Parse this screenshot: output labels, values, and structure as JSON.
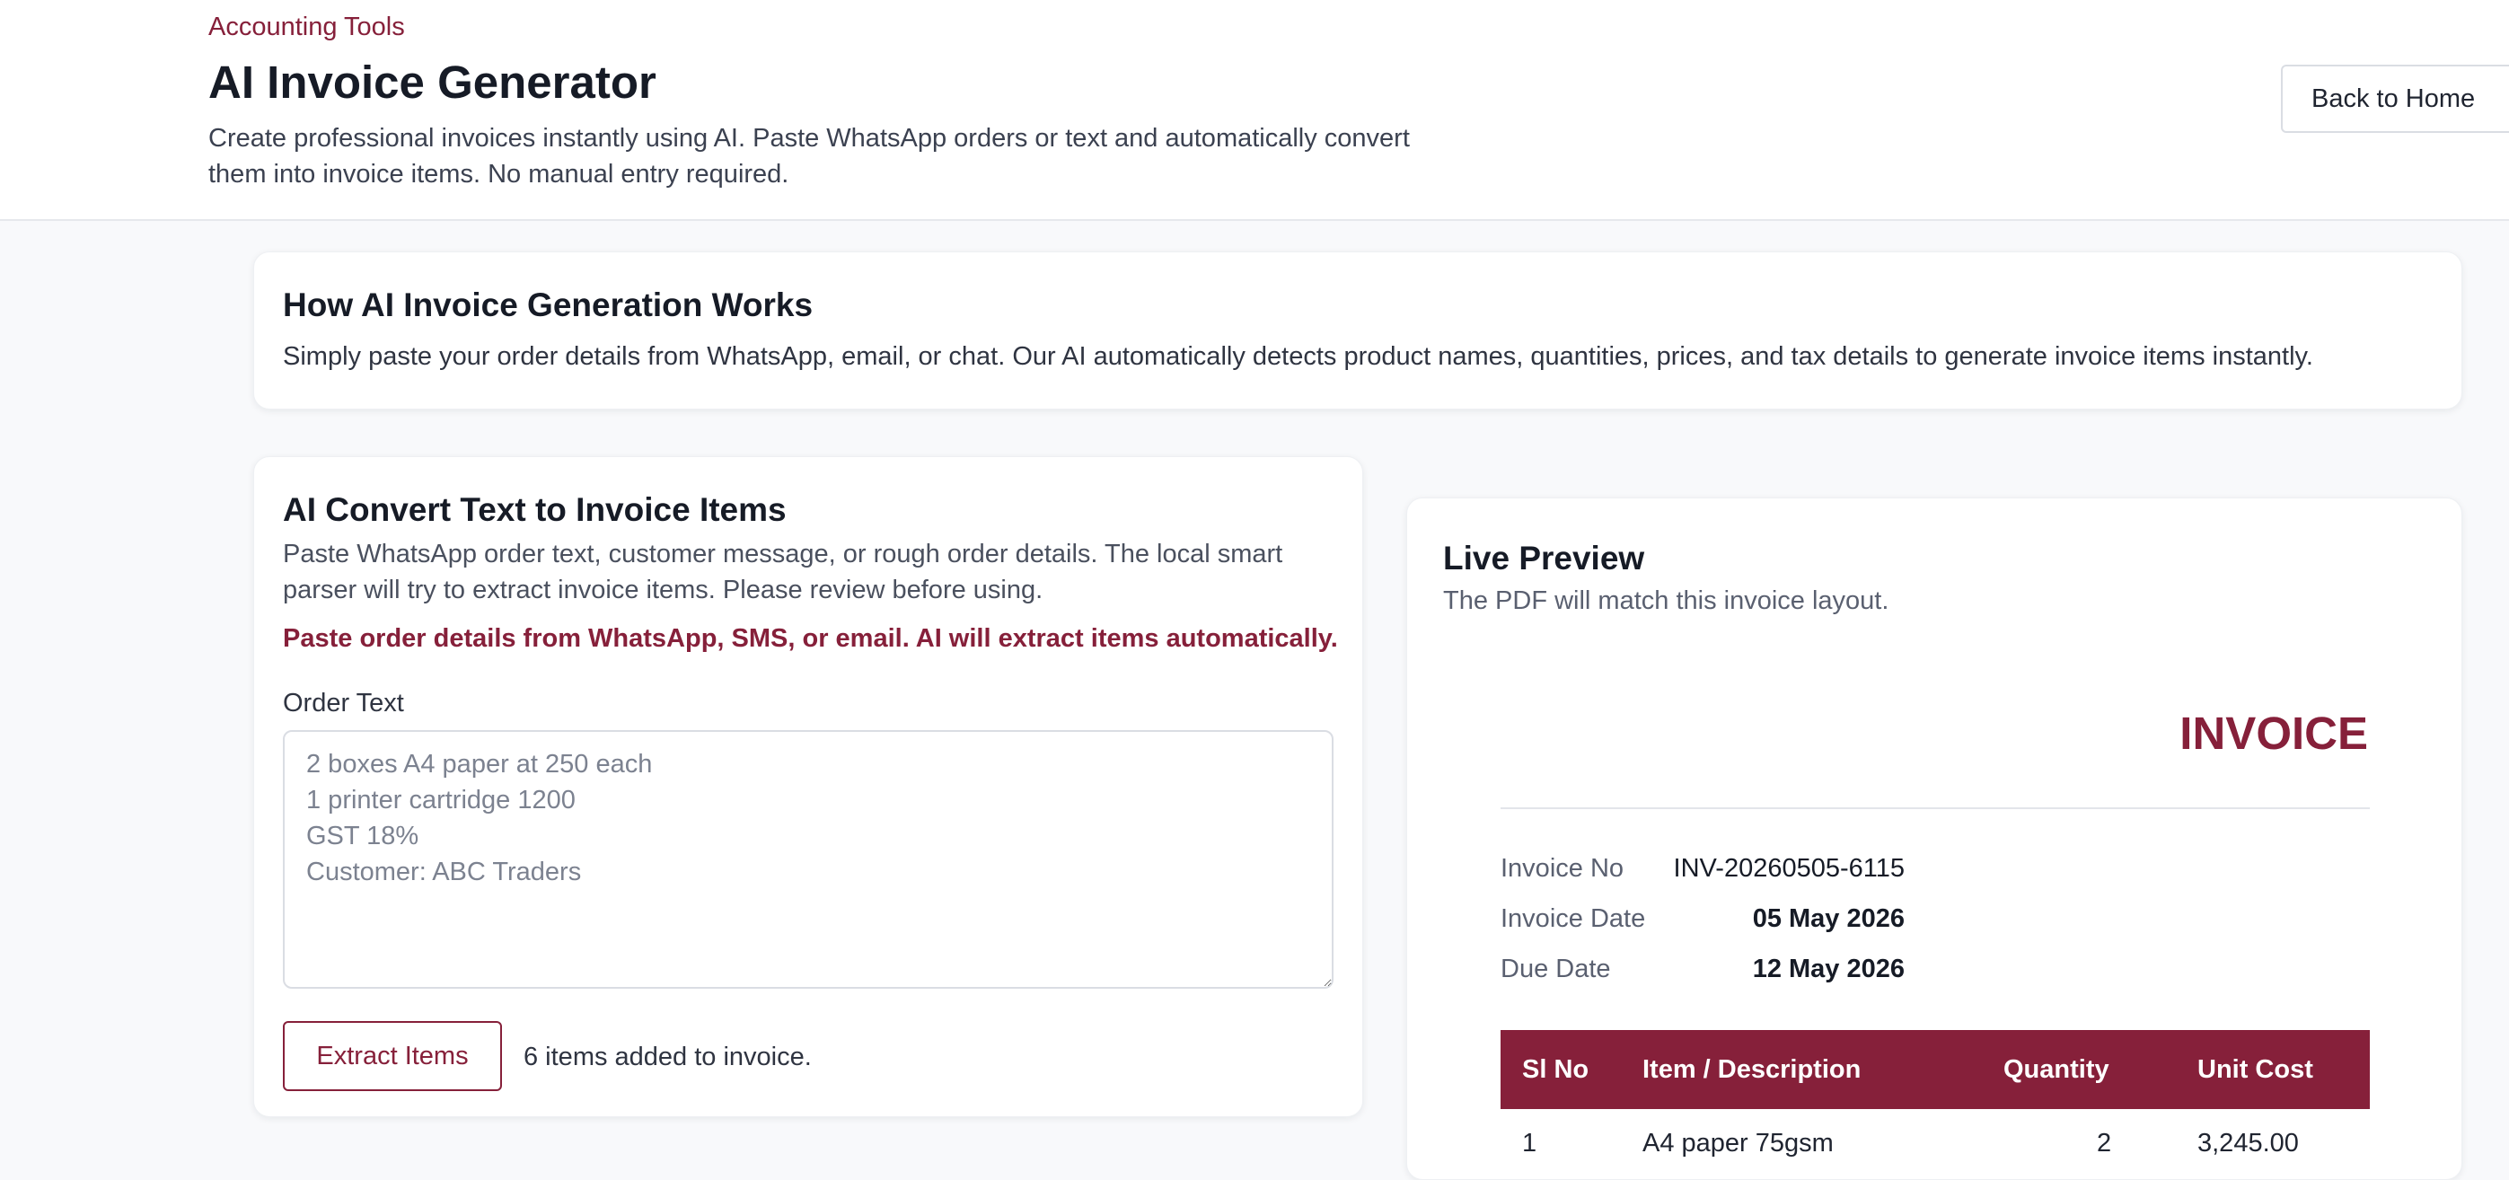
{
  "header": {
    "eyebrow": "Accounting Tools",
    "title": "AI Invoice Generator",
    "subtitle": "Create professional invoices instantly using AI. Paste WhatsApp orders or text and automatically convert them into invoice items. No manual entry required.",
    "back_label": "Back to Home"
  },
  "how": {
    "title": "How AI Invoice Generation Works",
    "text": "Simply paste your order details from WhatsApp, email, or chat. Our AI automatically detects product names, quantities, prices, and tax details to generate invoice items instantly."
  },
  "converter": {
    "title": "AI Convert Text to Invoice Items",
    "description": "Paste WhatsApp order text, customer message, or rough order details. The local smart parser will try to extract invoice items. Please review before using.",
    "hint": "Paste order details from WhatsApp, SMS, or email. AI will extract items automatically.",
    "field_label": "Order Text",
    "placeholder": "2 boxes A4 paper at 250 each\n1 printer cartridge 1200\nGST 18%\nCustomer: ABC Traders",
    "value": "",
    "extract_label": "Extract Items",
    "status": "6 items added to invoice."
  },
  "preview": {
    "title": "Live Preview",
    "subtitle": "The PDF will match this invoice layout.",
    "invoice_heading": "INVOICE",
    "meta": [
      {
        "label": "Invoice No",
        "value": "INV-20260505-6115"
      },
      {
        "label": "Invoice Date",
        "value": "05 May 2026"
      },
      {
        "label": "Due Date",
        "value": "12 May 2026"
      }
    ],
    "table_headers": [
      "Sl No",
      "Item / Description",
      "Quantity",
      "Unit Cost"
    ],
    "first_row": [
      "1",
      "A4 paper 75gsm",
      "2",
      "3,245.00"
    ]
  },
  "colors": {
    "accent": "#86203a",
    "background": "#f8f9fb",
    "card": "#ffffff"
  }
}
